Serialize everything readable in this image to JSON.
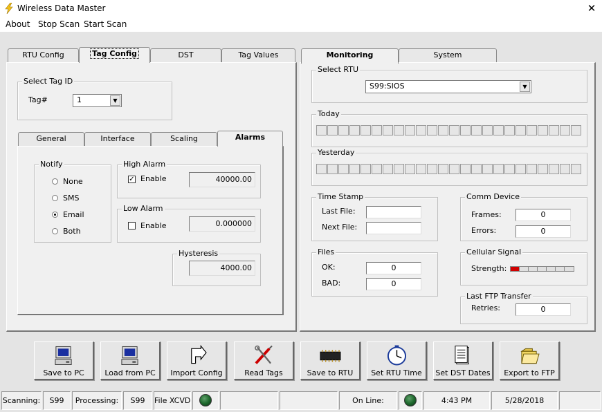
{
  "window": {
    "title": "Wireless Data Master",
    "close": "✕"
  },
  "menu": [
    "About",
    "Stop Scan",
    "Start Scan"
  ],
  "left_tabs": [
    "RTU Config",
    "Tag Config",
    "DST",
    "Tag Values"
  ],
  "select_tag": {
    "group": "Select Tag ID",
    "label": "Tag#",
    "value": "1"
  },
  "sub_tabs": [
    "General",
    "Interface",
    "Scaling",
    "Alarms"
  ],
  "notify": {
    "group": "Notify",
    "options": [
      "None",
      "SMS",
      "Email",
      "Both"
    ],
    "selected": "Email"
  },
  "high_alarm": {
    "group": "High Alarm",
    "enable_label": "Enable",
    "checked": true,
    "value": "40000.00"
  },
  "low_alarm": {
    "group": "Low Alarm",
    "enable_label": "Enable",
    "checked": false,
    "value": "0.000000"
  },
  "hysteresis": {
    "group": "Hysteresis",
    "value": "4000.00"
  },
  "right_tabs": [
    "Monitoring",
    "System"
  ],
  "select_rtu": {
    "group": "Select RTU",
    "value": "S99:SIOS"
  },
  "today": {
    "group": "Today"
  },
  "yesterday": {
    "group": "Yesterday"
  },
  "timestamp": {
    "group": "Time Stamp",
    "last_file_label": "Last File:",
    "last_file": "",
    "next_file_label": "Next File:",
    "next_file": ""
  },
  "files": {
    "group": "Files",
    "ok_label": "OK:",
    "ok": "0",
    "bad_label": "BAD:",
    "bad": "0"
  },
  "comm": {
    "group": "Comm Device",
    "frames_label": "Frames:",
    "frames": "0",
    "errors_label": "Errors:",
    "errors": "0"
  },
  "cellular": {
    "group": "Cellular Signal",
    "strength_label": "Strength:",
    "strength_bars": 1,
    "total_bars": 7,
    "bar_color": "#d00000"
  },
  "ftp": {
    "group": "Last FTP Transfer",
    "retries_label": "Retries:",
    "retries": "0"
  },
  "toolbar": [
    "Save to PC",
    "Load from PC",
    "Import Config",
    "Read Tags",
    "Save to RTU",
    "Set RTU Time",
    "Set DST Dates",
    "Export to FTP"
  ],
  "status": {
    "scanning_label": "Scanning:",
    "scanning": "S99",
    "processing_label": "Processing:",
    "processing": "S99",
    "file": "File XCVD",
    "online_label": "On Line:",
    "time": "4:43 PM",
    "date": "5/28/2018"
  },
  "colors": {
    "accent_led": "#1f6a2e",
    "signal": "#d00000"
  }
}
